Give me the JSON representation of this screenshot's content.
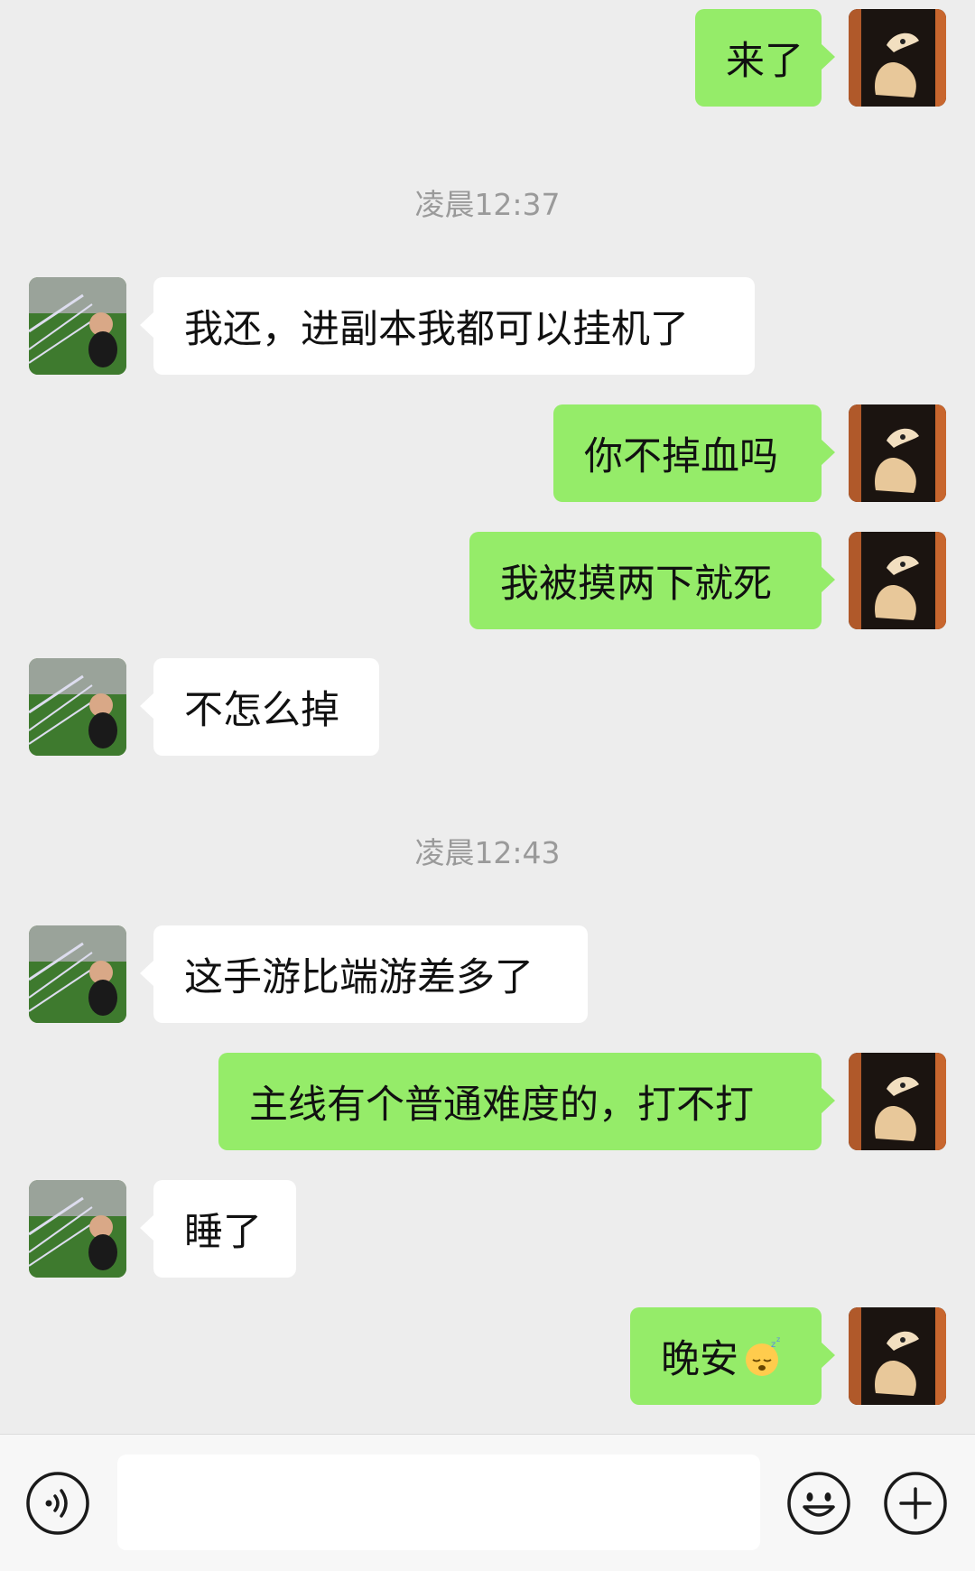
{
  "messages": [
    {
      "side": "me",
      "text": "来了"
    },
    {
      "timestamp": "凌晨12:37"
    },
    {
      "side": "them",
      "text": "我还，进副本我都可以挂机了"
    },
    {
      "side": "me",
      "text": "你不掉血吗"
    },
    {
      "side": "me",
      "text": "我被摸两下就死"
    },
    {
      "side": "them",
      "text": "不怎么掉"
    },
    {
      "timestamp": "凌晨12:43"
    },
    {
      "side": "them",
      "text": "这手游比端游差多了"
    },
    {
      "side": "me",
      "text": "主线有个普通难度的，打不打"
    },
    {
      "side": "them",
      "text": "睡了"
    },
    {
      "side": "me",
      "text": "晚安",
      "emoji": "sleeping-face-icon"
    }
  ],
  "input": {
    "placeholder": "",
    "value": ""
  },
  "icons": {
    "voice": "voice-icon",
    "emoji": "emoji-icon",
    "plus": "plus-icon"
  },
  "colors": {
    "background": "#ededed",
    "sent_bubble": "#95ec69",
    "received_bubble": "#ffffff",
    "timestamp_text": "#9a9a9a"
  }
}
